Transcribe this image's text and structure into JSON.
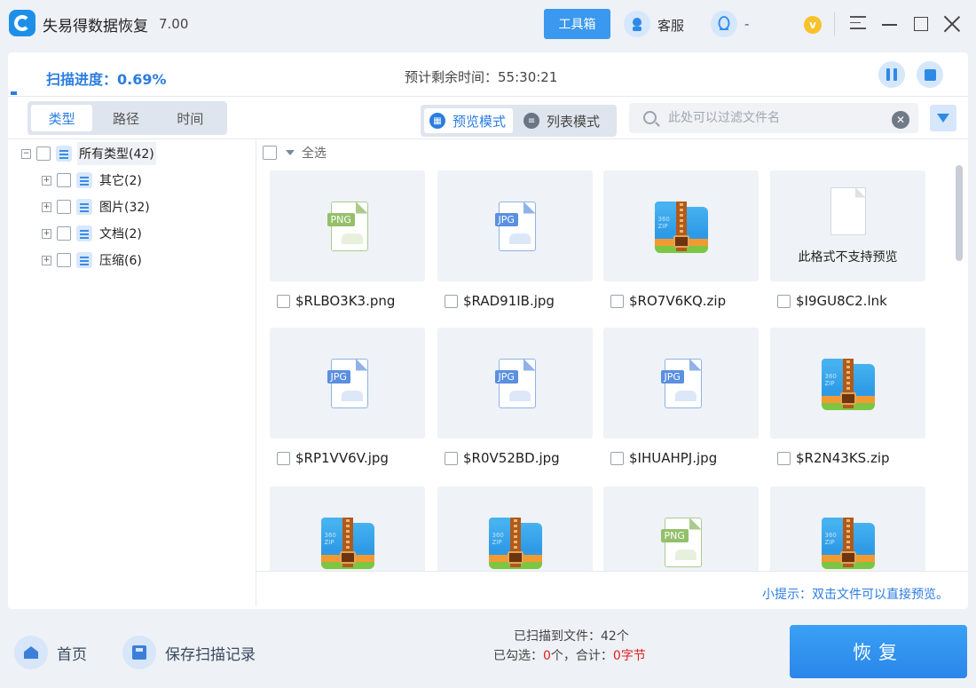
{
  "app": {
    "title": "失易得数据恢复",
    "version": "7.00",
    "toolbox_label": "工具箱",
    "service_label": "客服",
    "qq_label": "-"
  },
  "scan": {
    "progress_label": "扫描进度：0.69%",
    "progress_percent": 0.69,
    "eta_label": "预计剩余时间：",
    "eta_value": "55:30:21"
  },
  "view_tabs": [
    "类型",
    "路径",
    "时间"
  ],
  "modes": {
    "preview": "预览模式",
    "list": "列表模式"
  },
  "search": {
    "placeholder": "此处可以过滤文件名"
  },
  "tree": {
    "root": "所有类型(42)",
    "children": [
      "其它(2)",
      "图片(32)",
      "文档(2)",
      "压缩(6)"
    ]
  },
  "grid": {
    "select_all": "全选",
    "no_preview_text": "此格式不支持预览",
    "files": [
      {
        "name": "$RLBO3K3.png",
        "kind": "png"
      },
      {
        "name": "$RAD91IB.jpg",
        "kind": "jpg"
      },
      {
        "name": "$RO7V6KQ.zip",
        "kind": "zip"
      },
      {
        "name": "$I9GU8C2.lnk",
        "kind": "none"
      },
      {
        "name": "$RP1VV6V.jpg",
        "kind": "jpg"
      },
      {
        "name": "$R0V52BD.jpg",
        "kind": "jpg"
      },
      {
        "name": "$IHUAHPJ.jpg",
        "kind": "jpg"
      },
      {
        "name": "$R2N43KS.zip",
        "kind": "zip"
      },
      {
        "name": "",
        "kind": "zip"
      },
      {
        "name": "",
        "kind": "zip"
      },
      {
        "name": "",
        "kind": "png"
      },
      {
        "name": "",
        "kind": "zip"
      }
    ]
  },
  "tip": "小提示：双击文件可以直接预览。",
  "footer": {
    "home_label": "首页",
    "save_label": "保存扫描记录",
    "scanned_label": "已扫描到文件：42个",
    "selected_prefix": "已勾选：",
    "selected_count": "0",
    "selected_unit": "个，合计：",
    "selected_size": "0字节",
    "recover_label": "恢复"
  },
  "colors": {
    "accent": "#2b7de0",
    "button": "#3a98ee",
    "warning": "#e02020"
  }
}
